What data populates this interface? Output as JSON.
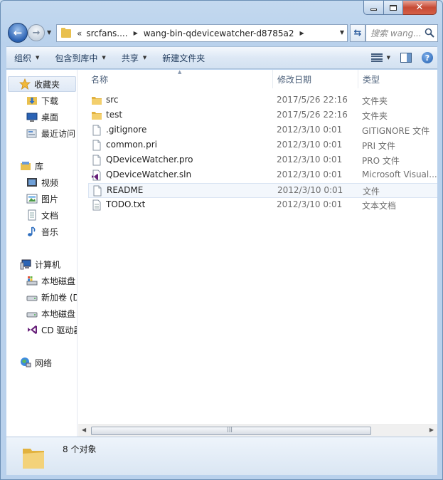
{
  "window": {
    "caption_buttons": {
      "minimize": "–",
      "maximize": "□",
      "close": "✕"
    }
  },
  "nav": {
    "back_glyph": "←",
    "forward_glyph": "→",
    "address": {
      "chevron": "«",
      "segments": [
        "srcfans....",
        "wang-bin-qdevicewatcher-d8785a2"
      ]
    },
    "search_placeholder": "搜索 wang..."
  },
  "toolbar": {
    "organize": "组织",
    "include_library": "包含到库中",
    "share": "共享",
    "new_folder": "新建文件夹",
    "help": "?"
  },
  "sidebar": {
    "favorites": {
      "label": "收藏夹",
      "items": [
        "下载",
        "桌面",
        "最近访问"
      ]
    },
    "libraries": {
      "label": "库",
      "items": [
        "视频",
        "图片",
        "文档",
        "音乐"
      ]
    },
    "computer": {
      "label": "计算机",
      "items": [
        "本地磁盘",
        "新加卷 (D",
        "本地磁盘",
        "CD 驱动器"
      ]
    },
    "network": {
      "label": "网络"
    }
  },
  "columns": {
    "name": "名称",
    "date": "修改日期",
    "type": "类型"
  },
  "files": [
    {
      "name": "src",
      "date": "2017/5/26 22:16",
      "type": "文件夹",
      "icon": "folder-icon"
    },
    {
      "name": "test",
      "date": "2017/5/26 22:16",
      "type": "文件夹",
      "icon": "folder-icon"
    },
    {
      "name": ".gitignore",
      "date": "2012/3/10 0:01",
      "type": "GITIGNORE 文件",
      "icon": "file-icon"
    },
    {
      "name": "common.pri",
      "date": "2012/3/10 0:01",
      "type": "PRI 文件",
      "icon": "file-icon"
    },
    {
      "name": "QDeviceWatcher.pro",
      "date": "2012/3/10 0:01",
      "type": "PRO 文件",
      "icon": "file-icon"
    },
    {
      "name": "QDeviceWatcher.sln",
      "date": "2012/3/10 0:01",
      "type": "Microsoft Visual...",
      "icon": "visual-studio-icon"
    },
    {
      "name": "README",
      "date": "2012/3/10 0:01",
      "type": "文件",
      "icon": "file-icon"
    },
    {
      "name": "TODO.txt",
      "date": "2012/3/10 0:01",
      "type": "文本文档",
      "icon": "text-file-icon"
    }
  ],
  "status": {
    "count": "8 个对象"
  },
  "colors": {
    "accent": "#2b62b3",
    "folder": "#e9c04e",
    "window_frame": "#c4d9ef"
  }
}
